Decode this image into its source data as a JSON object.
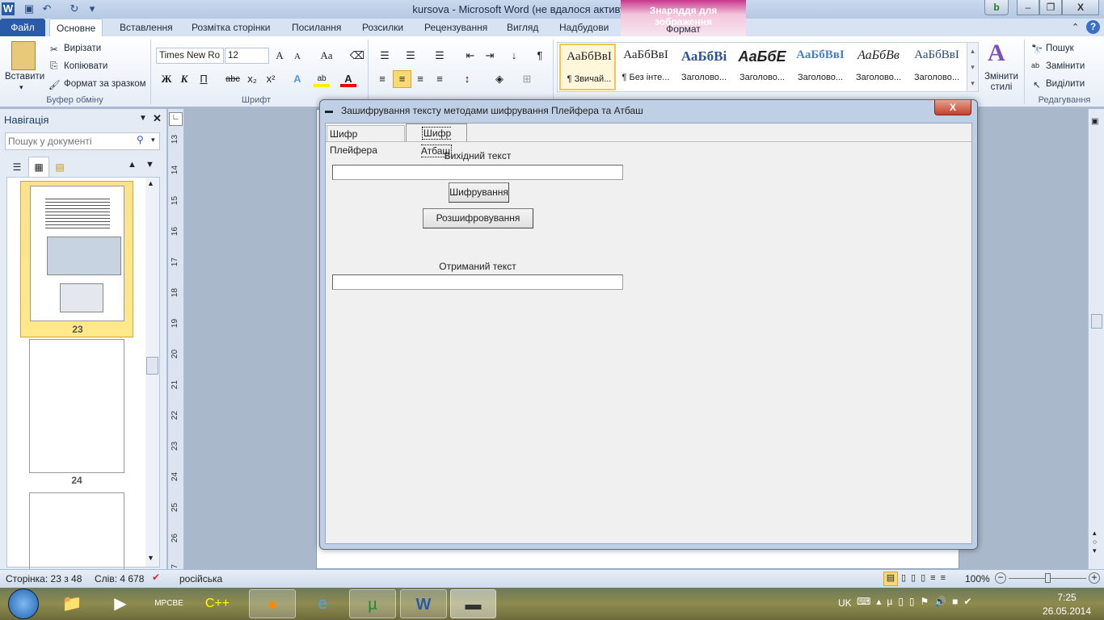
{
  "window": {
    "title": "kursova  -  Microsoft Word (не вдалося активувати продукт)",
    "context_group": "Знаряддя для зображення",
    "context_tab": "Формат"
  },
  "tabs": [
    "Файл",
    "Основне",
    "Вставлення",
    "Розмітка сторінки",
    "Посилання",
    "Розсилки",
    "Рецензування",
    "Вигляд",
    "Надбудови"
  ],
  "clipboard": {
    "paste": "Вставити",
    "cut": "Вирізати",
    "copy": "Копіювати",
    "format_painter": "Формат за зразком",
    "label": "Буфер обміну"
  },
  "font": {
    "name": "Times New Ro",
    "size": "12",
    "label": "Шрифт",
    "bold": "Ж",
    "italic": "К",
    "underline": "П",
    "strike": "abc",
    "sub": "x₂",
    "sup": "x²",
    "grow": "A",
    "change_case": "Aa"
  },
  "styles": [
    {
      "preview": "АаБбВвІ",
      "label": "¶ Звичай..."
    },
    {
      "preview": "АаБбВвІ",
      "label": "¶ Без інте..."
    },
    {
      "preview": "АаБбВі",
      "label": "Заголово..."
    },
    {
      "preview": "АаБбЕ",
      "label": "Заголово..."
    },
    {
      "preview": "АаБбВвІ",
      "label": "Заголово..."
    },
    {
      "preview": "АаБбВв",
      "label": "Заголово..."
    },
    {
      "preview": "АаБбВвІ",
      "label": "Заголово..."
    }
  ],
  "change_styles": "Змінити стилі",
  "editing": {
    "find": "Пошук",
    "replace": "Замінити",
    "select": "Виділити",
    "label": "Редагування"
  },
  "nav": {
    "title": "Навігація",
    "search_placeholder": "Пошук у документі",
    "pages": [
      "23",
      "24"
    ]
  },
  "ruler": [
    "13",
    "14",
    "15",
    "16",
    "17",
    "18",
    "19",
    "20",
    "21",
    "22",
    "23",
    "24",
    "25",
    "26",
    "27"
  ],
  "dialog": {
    "title": "Зашифрування тексту методами шифрування Плейфера та Атбаш",
    "tabs": [
      "Шифр Плейфера",
      "Шифр Атбаш"
    ],
    "source_label": "Вихідний текст",
    "source_value": "",
    "encrypt": "Шифрування",
    "decrypt": "Розшифровування",
    "result_label": "Отриманий текст",
    "result_value": ""
  },
  "status": {
    "page": "Сторінка: 23 з 48",
    "words": "Слів: 4 678",
    "language": "російська",
    "zoom": "100%",
    "zoom_percent": 100
  },
  "tray": {
    "lang": "UK",
    "time": "7:25",
    "date": "26.05.2014"
  },
  "taskbar": [
    "Провідник",
    "Media Player",
    "MPC-BE",
    "C++",
    "Firefox",
    "Internet Explorer",
    "uTorrent",
    "Word",
    "Програма"
  ]
}
